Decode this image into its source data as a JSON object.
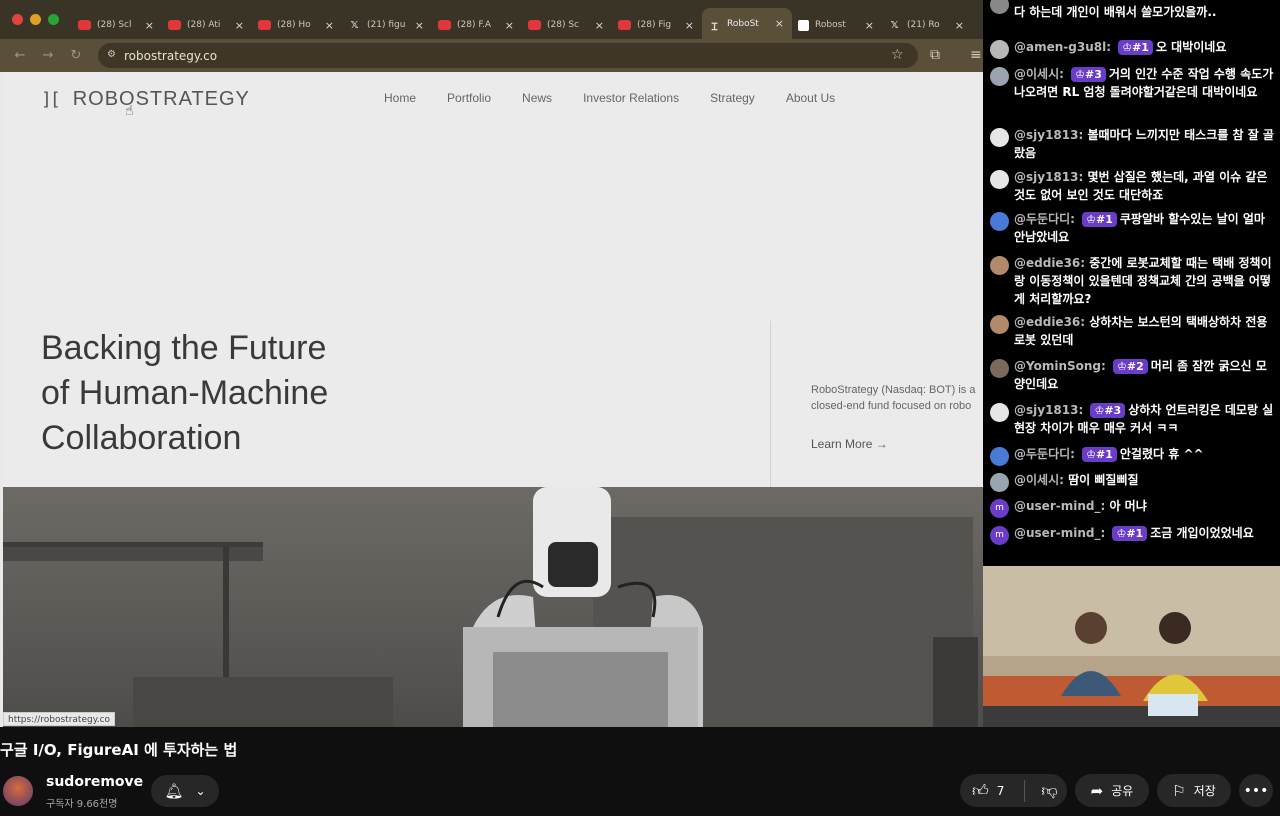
{
  "browser": {
    "tabs": [
      {
        "label": "(28) Scl",
        "icon": "youtube-icon"
      },
      {
        "label": "(28) Ati",
        "icon": "youtube-icon"
      },
      {
        "label": "(28) Ho",
        "icon": "youtube-icon"
      },
      {
        "label": "(21) figu",
        "icon": "x-icon"
      },
      {
        "label": "(28) F.A",
        "icon": "youtube-icon"
      },
      {
        "label": "(28) Sc",
        "icon": "youtube-icon"
      },
      {
        "label": "(28) Fig",
        "icon": "youtube-icon"
      },
      {
        "label": "RoboSt",
        "icon": "robostrategy-icon"
      },
      {
        "label": "Robost",
        "icon": "figure-icon"
      },
      {
        "label": "(21) Ro",
        "icon": "x-icon"
      }
    ],
    "url": "robostrategy.co",
    "status_url": "https://robostrategy.co"
  },
  "site": {
    "logo_mark": "][",
    "logo_text": "ROBOSTRATEGY",
    "nav": [
      "Home",
      "Portfolio",
      "News",
      "Investor Relations",
      "Strategy",
      "About Us"
    ],
    "hero": "Backing the Future\nof Human-Machine\nCollaboration",
    "desc_line1": "RoboStrategy (Nasdaq: BOT) is a",
    "desc_line2": "closed-end fund focused on robo",
    "learn_more": "Learn More →"
  },
  "chat": [
    {
      "user": "",
      "badge": "",
      "text": "다 하는데 개인이 배워서 쓸모가있을까..",
      "avatar": "#888"
    },
    {
      "user": "@amen-g3u8l:",
      "badge": "♔#1",
      "text": "오 대박이네요",
      "avatar": "#b8b8b8"
    },
    {
      "user": "@이세시:",
      "badge": "♔#3",
      "text": "거의 인간 수준 작업 수행 속도가 나오려면 RL 엄청 돌려야할거같은데 대박이네요",
      "avatar": "#9aa4b0"
    },
    {
      "user": "@sjy1813:",
      "badge": "",
      "text": "볼때마다 느끼지만 태스크를 참 잘 골랐음",
      "avatar": "#e6e6e6"
    },
    {
      "user": "@sjy1813:",
      "badge": "",
      "text": "몇번 삽질은 했는데, 과열 이슈 같은 것도 없어 보인 것도 대단하죠",
      "avatar": "#e6e6e6"
    },
    {
      "user": "@두둔다디:",
      "badge": "♔#1",
      "text": "쿠팡알바 할수있는 날이 얼마 안남았네요",
      "avatar": "#4a7ad8"
    },
    {
      "user": "@eddie36:",
      "badge": "",
      "text": "중간에 로봇교체할 때는 택배 정책이랑 이동정책이 있을텐데 정책교체 간의 공백을 어떻게 처리할까요?",
      "avatar": "#b08a6a"
    },
    {
      "user": "@eddie36:",
      "badge": "",
      "text": "상하차는 보스턴의 택배상하차 전용로봇 있던데",
      "avatar": "#b08a6a"
    },
    {
      "user": "@YominSong:",
      "badge": "♔#2",
      "text": "머리 좀 잠깐 굵으신 모양인데요",
      "avatar": "#7a6a5a"
    },
    {
      "user": "@sjy1813:",
      "badge": "♔#3",
      "text": "상하차 언트러킹은 데모랑 실 현장 차이가 매우 매우 커서 ㅋㅋ",
      "avatar": "#e6e6e6"
    },
    {
      "user": "@두둔다디:",
      "badge": "♔#1",
      "text": "안걸렸다 휴 ^^",
      "avatar": "#4a7ad8"
    },
    {
      "user": "@이세시:",
      "badge": "",
      "text": "땀이 삐질삐질",
      "avatar": "#9aa4b0"
    },
    {
      "user": "@user-mind_:",
      "badge": "",
      "text": "아 머냐",
      "avatar": "#6a3cc8",
      "initial": "m"
    },
    {
      "user": "@user-mind_:",
      "badge": "♔#1",
      "text": "조금 개입이었었네요",
      "avatar": "#6a3cc8",
      "initial": "m"
    }
  ],
  "video": {
    "title": "구글 I/O, FigureAI 에 투자하는 법",
    "channel": "sudoremove",
    "subscribers": "구독자 9.66천명",
    "likes": "7",
    "share": "공유",
    "save": "저장"
  }
}
